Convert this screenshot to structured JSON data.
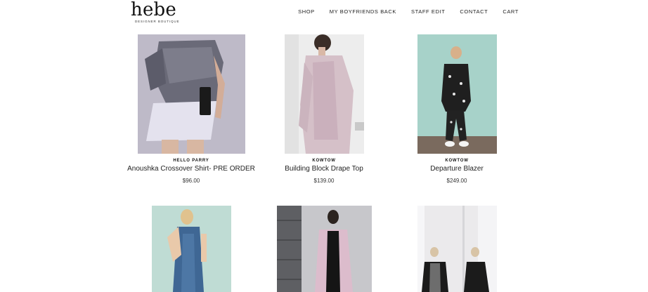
{
  "header": {
    "logo_text": "hebe",
    "logo_tagline": "DESIGNER BOUTIQUE",
    "nav": [
      "SHOP",
      "MY BOYFRIENDS BACK",
      "STAFF EDIT",
      "CONTACT",
      "CART"
    ]
  },
  "products": [
    {
      "brand": "HELLO PARRY",
      "title": "Anoushka Crossover Shirt- PRE ORDER",
      "price": "$96.00"
    },
    {
      "brand": "KOWTOW",
      "title": "Building Block Drape Top",
      "price": "$139.00"
    },
    {
      "brand": "KOWTOW",
      "title": "Departure Blazer",
      "price": "$249.00"
    }
  ],
  "second_row_images": [
    "blue-denim-dress-photo",
    "pink-cardigan-photo",
    "black-coat-photo"
  ]
}
